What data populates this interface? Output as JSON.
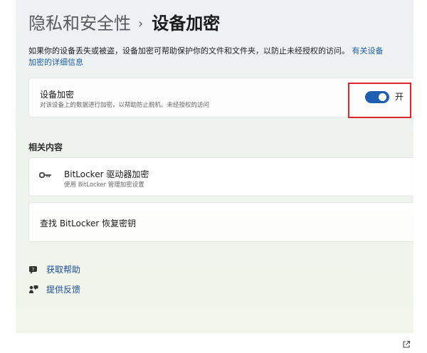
{
  "breadcrumb": {
    "parent": "隐私和安全性",
    "separator": "›",
    "current": "设备加密"
  },
  "description": {
    "line1": "如果你的设备丢失或被盗，设备加密可帮助保护你的文件和文件夹，以防止未经授权的访问。",
    "link_part1": "有关设备",
    "link_part2": "加密的详细信息"
  },
  "device_encryption": {
    "title": "设备加密",
    "subtitle": "对该设备上的数据进行加密，以帮助防止脱机、未经授权的访问",
    "toggle_on": true,
    "toggle_label": "开"
  },
  "related": {
    "heading": "相关内容",
    "bitlocker": {
      "title": "BitLocker 驱动器加密",
      "subtitle": "使用 BitLocker 管理加密设置"
    },
    "recovery": {
      "title": "查找 BitLocker 恢复密钥"
    }
  },
  "help": {
    "get_help": "获取帮助",
    "feedback": "提供反馈"
  },
  "colors": {
    "accent": "#1f5fb1",
    "highlight": "#e0262a",
    "link": "#1a4f9c"
  },
  "icons": [
    "chevron-right-icon",
    "key-icon",
    "external-link-icon",
    "help-icon",
    "feedback-icon"
  ]
}
